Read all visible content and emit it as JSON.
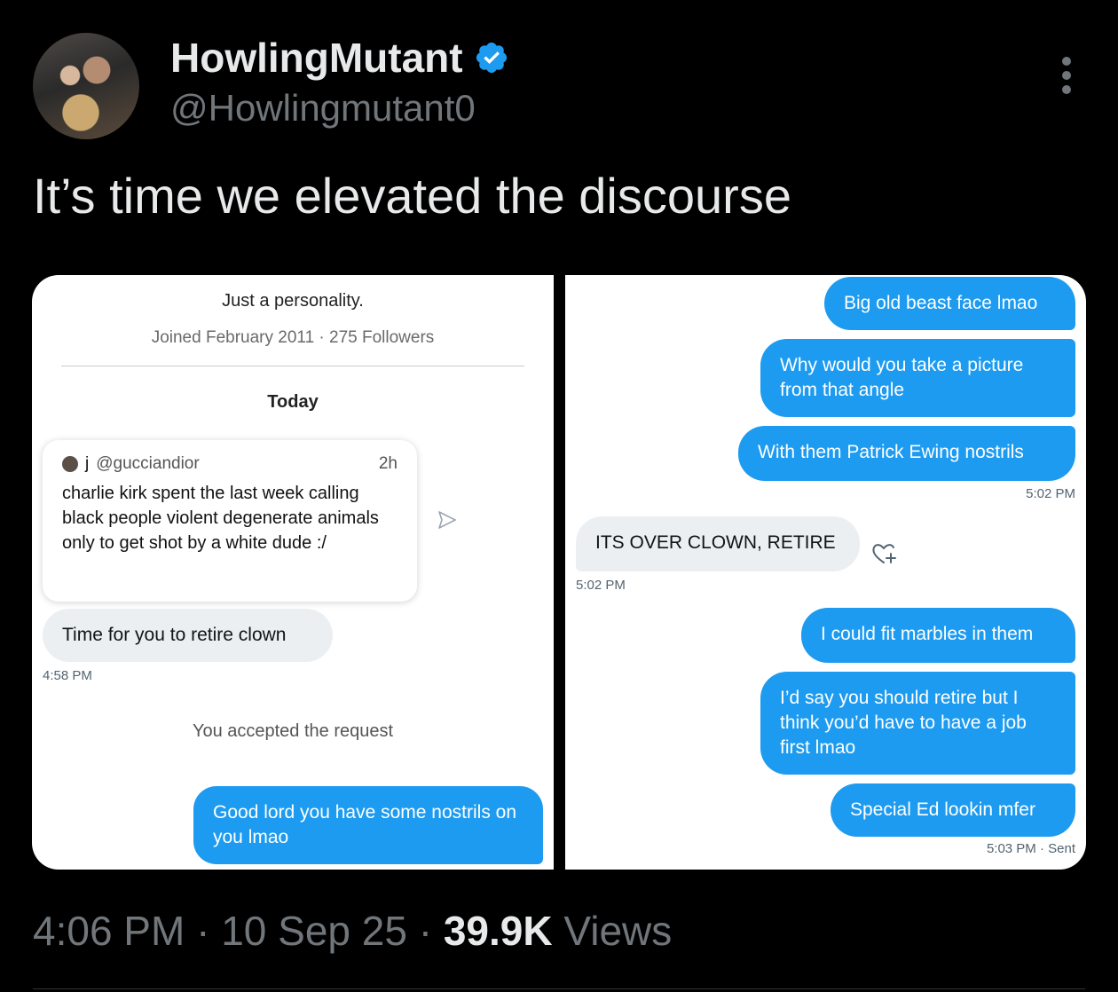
{
  "author": {
    "display_name": "HowlingMutant",
    "handle": "@Howlingmutant0",
    "verified": true,
    "avatar_icon": "avatar-photo"
  },
  "tweet": {
    "text": "It’s time we elevated the discourse"
  },
  "left_screenshot": {
    "bio": "Just a personality.",
    "joined": "Joined February 2011 · 275 Followers",
    "day_label": "Today",
    "quoted_post": {
      "name": "j",
      "handle": "@gucciandior",
      "time": "2h",
      "text": "charlie kirk spent the last week calling black people violent degenerate animals only to get shot by a white dude :/"
    },
    "received_message": "Time for you to retire clown",
    "received_time": "4:58 PM",
    "system_message": "You accepted the request",
    "sent_message": "Good lord you have some nostrils on you lmao"
  },
  "right_screenshot": {
    "sent_1": "Big old beast face lmao",
    "sent_2": "Why would you take a picture from that angle",
    "sent_3": "With them Patrick Ewing nostrils",
    "sent_time_1": "5:02 PM",
    "received_message": "ITS OVER CLOWN, RETIRE",
    "received_time": "5:02 PM",
    "sent_4": "I could fit marbles in them",
    "sent_5": "I’d say you should retire but I think you’d have to have a job first lmao",
    "sent_6": "Special Ed lookin mfer",
    "sent_time_2": "5:03 PM · Sent"
  },
  "footer": {
    "time": "4:06 PM",
    "separator": "·",
    "date": "10 Sep 25",
    "views_count": "39.9K",
    "views_label": "Views"
  },
  "colors": {
    "background": "#000000",
    "text_primary": "#e7e9ea",
    "text_secondary": "#71767b",
    "dm_blue": "#1d9bf0",
    "dm_gray": "#eceff1",
    "verified_blue": "#1d9bf0"
  }
}
